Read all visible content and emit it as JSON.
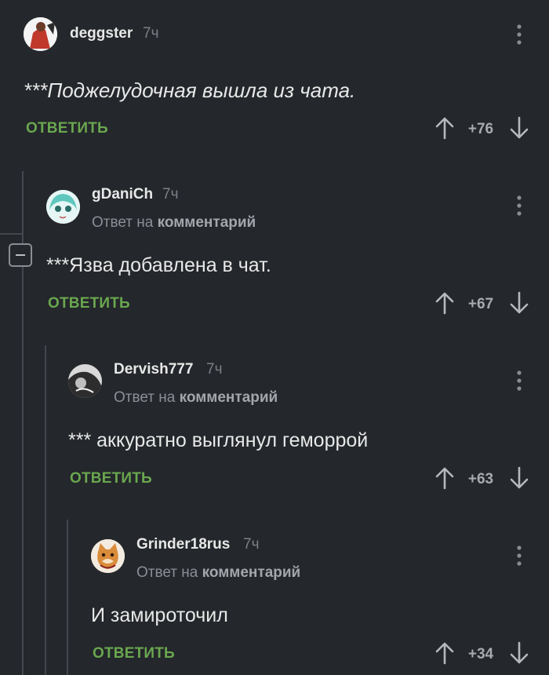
{
  "comments": [
    {
      "username": "deggster",
      "time": "7ч",
      "text": "***Поджелудочная вышла из чата.",
      "reply_label": "ОТВЕТИТЬ",
      "rating": "+76"
    },
    {
      "username": "gDaniCh",
      "time": "7ч",
      "reply_prefix": "Ответ на",
      "reply_target": "комментарий",
      "text": "***Язва добавлена в чат.",
      "reply_label": "ОТВЕТИТЬ",
      "rating": "+67"
    },
    {
      "username": "Dervish777",
      "time": "7ч",
      "reply_prefix": "Ответ на",
      "reply_target": "комментарий",
      "text": "*** аккуратно выглянул геморрой",
      "reply_label": "ОТВЕТИТЬ",
      "rating": "+63"
    },
    {
      "username": "Grinder18rus",
      "time": "7ч",
      "reply_prefix": "Ответ на",
      "reply_target": "комментарий",
      "text": "И замироточил",
      "reply_label": "ОТВЕТИТЬ",
      "rating": "+34"
    }
  ],
  "colors": {
    "background": "#24272b",
    "reply_green": "#6aa74f",
    "thread_line": "#43474d"
  },
  "icons": [
    "avatar",
    "more-options-icon",
    "upvote-arrow-icon",
    "downvote-arrow-icon",
    "collapse-thread-icon"
  ]
}
